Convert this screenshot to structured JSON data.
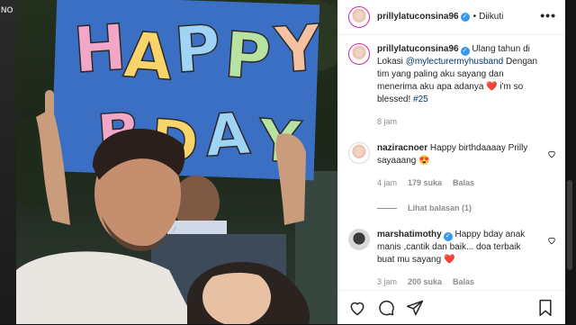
{
  "backdrop": {
    "left_text": "NO"
  },
  "photo": {
    "sign_word_1": [
      "H",
      "A",
      "P",
      "P",
      "Y"
    ],
    "sign_word_2": [
      "B",
      "D",
      "A",
      "Y"
    ],
    "letter_colors": [
      "#f2a6c8",
      "#f9d46a",
      "#9fd4f5",
      "#b7e2a0",
      "#f6c1a0"
    ]
  },
  "header": {
    "username": "prillylatuconsina96",
    "follow_status": "Diikuti",
    "more_label": "•••"
  },
  "caption": {
    "username": "prillylatuconsina96",
    "text_1": "Ulang tahun di Lokasi ",
    "mention": "@mylecturermyhusband",
    "text_2": " Dengan tim yang paling aku sayang dan menerima aku apa adanya ",
    "text_3": " i'm so blessed! ",
    "hashtag": "#25",
    "time": "8 jam"
  },
  "comments": [
    {
      "username": "naziracnoer",
      "text": "Happy birthdaaaay Prilly sayaaang",
      "emoji": "😍",
      "time": "4 jam",
      "likes": "179 suka",
      "reply_label": "Balas",
      "view_replies": "Lihat balasan (1)"
    },
    {
      "username": "marshatimothy",
      "text": "Happy bday anak manis ,cantik dan baik... doa terbaik buat mu sayang",
      "emoji": "❤️",
      "time": "3 jam",
      "likes": "200 suka",
      "reply_label": "Balas"
    }
  ],
  "icons": {
    "verified": "✓",
    "heart_emoji": "❤️"
  }
}
